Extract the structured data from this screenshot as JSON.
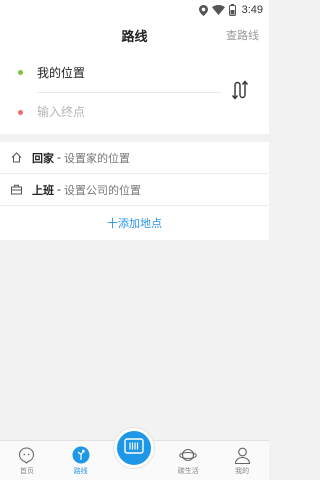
{
  "status_bar": {
    "time": "3:49",
    "icons": [
      "location-icon",
      "wifi-icon",
      "battery-icon"
    ]
  },
  "header": {
    "title": "路线",
    "action_label": "查路线"
  },
  "route": {
    "start_label": "我的位置",
    "end_placeholder": "输入终点",
    "end_value": ""
  },
  "places": {
    "home": {
      "name": "回家",
      "separator": "-",
      "hint": "设置家的位置",
      "icon": "home-icon"
    },
    "work": {
      "name": "上班",
      "separator": "-",
      "hint": "设置公司的位置",
      "icon": "briefcase-icon"
    },
    "add_label": "十添加地点"
  },
  "bottom_nav": {
    "items": [
      {
        "label": "首页",
        "icon": "home-face-icon",
        "active": false
      },
      {
        "label": "路线",
        "icon": "route-icon",
        "active": true
      },
      {
        "label": "",
        "icon": "scan-card-icon",
        "active": false
      },
      {
        "label": "碳生活",
        "icon": "planet-icon",
        "active": false
      },
      {
        "label": "我的",
        "icon": "user-icon",
        "active": false
      }
    ]
  },
  "colors": {
    "accent": "#1e97e6",
    "start_dot": "#7ec242",
    "end_dot": "#f26b6b",
    "link": "#2a93e8"
  }
}
